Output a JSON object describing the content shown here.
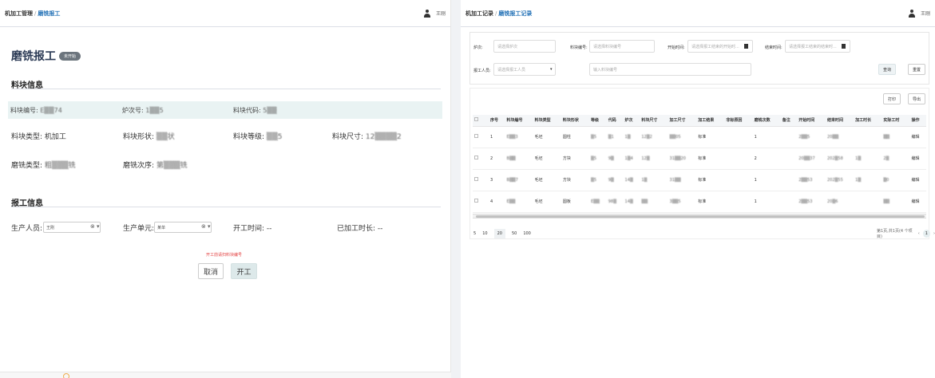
{
  "left": {
    "breadcrumb": {
      "parent": "机加工管理",
      "sep": "/",
      "current": "磨铣报工"
    },
    "user": "王刚",
    "title": "磨铣报工",
    "badge": "未开始",
    "section_material": "料块信息",
    "material": {
      "code_label": "料块编号:",
      "code_value": "E▒▒74",
      "heat_label": "炉次号:",
      "heat_value": "1▒▒5",
      "mcode_label": "料块代码:",
      "mcode_value": "5▒▒",
      "type_label": "料块类型:",
      "type_value": "机加工",
      "shape_label": "料块形状:",
      "shape_value": "▒▒状",
      "grade_label": "料块等级:",
      "grade_value": "▒▒5",
      "size_label": "料块尺寸:",
      "size_value": "12▒▒▒▒2",
      "mill_type_label": "磨铣类型:",
      "mill_type_value": "粗▒▒▒铣",
      "mill_order_label": "磨铣次序:",
      "mill_order_value": "第▒▒▒铣"
    },
    "section_report": "报工信息",
    "report": {
      "producer_label": "生产人员:",
      "producer_value": "王刚",
      "unit_label": "生产单元:",
      "unit_value": "某单",
      "start_label": "开工时间:",
      "start_value": "--",
      "duration_label": "已加工时长:",
      "duration_value": "--"
    },
    "warning": "开工前请扫料块编号",
    "cancel_label": "取消",
    "start_label": "开工"
  },
  "right": {
    "breadcrumb": {
      "parent": "机加工记录",
      "sep": "/",
      "current": "磨铣报工记录"
    },
    "user": "王刚",
    "filters": {
      "heat_label": "炉次:",
      "heat_ph": "请选择炉次",
      "code_label": "料块编号:",
      "code_ph": "请选择料块编号",
      "start_label": "开始时间:",
      "start_ph": "请选择报工结束的开始时...",
      "end_label": "结束时间:",
      "end_ph": "请选择报工结束的结束时...",
      "reporter_label": "报工人员:",
      "reporter_ph": "请选择报工人员",
      "code_input_ph": "输入料块编号",
      "query_label": "查询",
      "reset_label": "重置"
    },
    "print_label": "打印",
    "export_label": "导出",
    "columns": [
      "序号",
      "料块编号",
      "料块类型",
      "料块形状",
      "等级",
      "代码",
      "炉次",
      "料块尺寸",
      "加工尺寸",
      "加工结果",
      "非标原因",
      "磨铣次数",
      "备注",
      "开始时间",
      "结束时间",
      "加工时长",
      "实际工时",
      "操作"
    ],
    "rows": [
      [
        "1",
        "E▒▒3",
        "毛坯",
        "圆柱",
        "▒5",
        "▒1",
        "1▒",
        "12▒2",
        "▒▒05",
        "标准",
        "",
        "1",
        "",
        "2▒▒5",
        "20▒▒",
        "",
        "▒▒",
        "编辑"
      ],
      [
        "2",
        "B▒▒",
        "毛坯",
        "方块",
        "▒5",
        "9▒",
        "1▒4",
        "12▒",
        "31▒▒20",
        "标准",
        "",
        "2",
        "",
        "20▒▒37",
        "202▒58",
        "1▒",
        "2▒",
        "编辑"
      ],
      [
        "3",
        "B▒▒7",
        "毛坯",
        "方块",
        "▒5",
        "9▒",
        "14▒",
        "1▒",
        "31▒▒",
        "标准",
        "",
        "1",
        "",
        "2▒▒53",
        "202▒55",
        "1▒",
        "▒0",
        "编辑"
      ],
      [
        "4",
        "E▒▒",
        "毛坯",
        "圆板",
        "E▒▒",
        "98▒",
        "14▒",
        "▒▒",
        "3▒▒5",
        "标准",
        "",
        "1",
        "",
        "2▒▒53",
        "20▒6",
        "",
        "▒▒",
        "编辑"
      ]
    ],
    "pager": {
      "sizes": [
        "5",
        "10",
        "20",
        "50",
        "100"
      ],
      "active_size": "20",
      "summary": "第1页,共1页(4 个项目)",
      "prev": "‹",
      "page": "1",
      "next": "›"
    }
  }
}
